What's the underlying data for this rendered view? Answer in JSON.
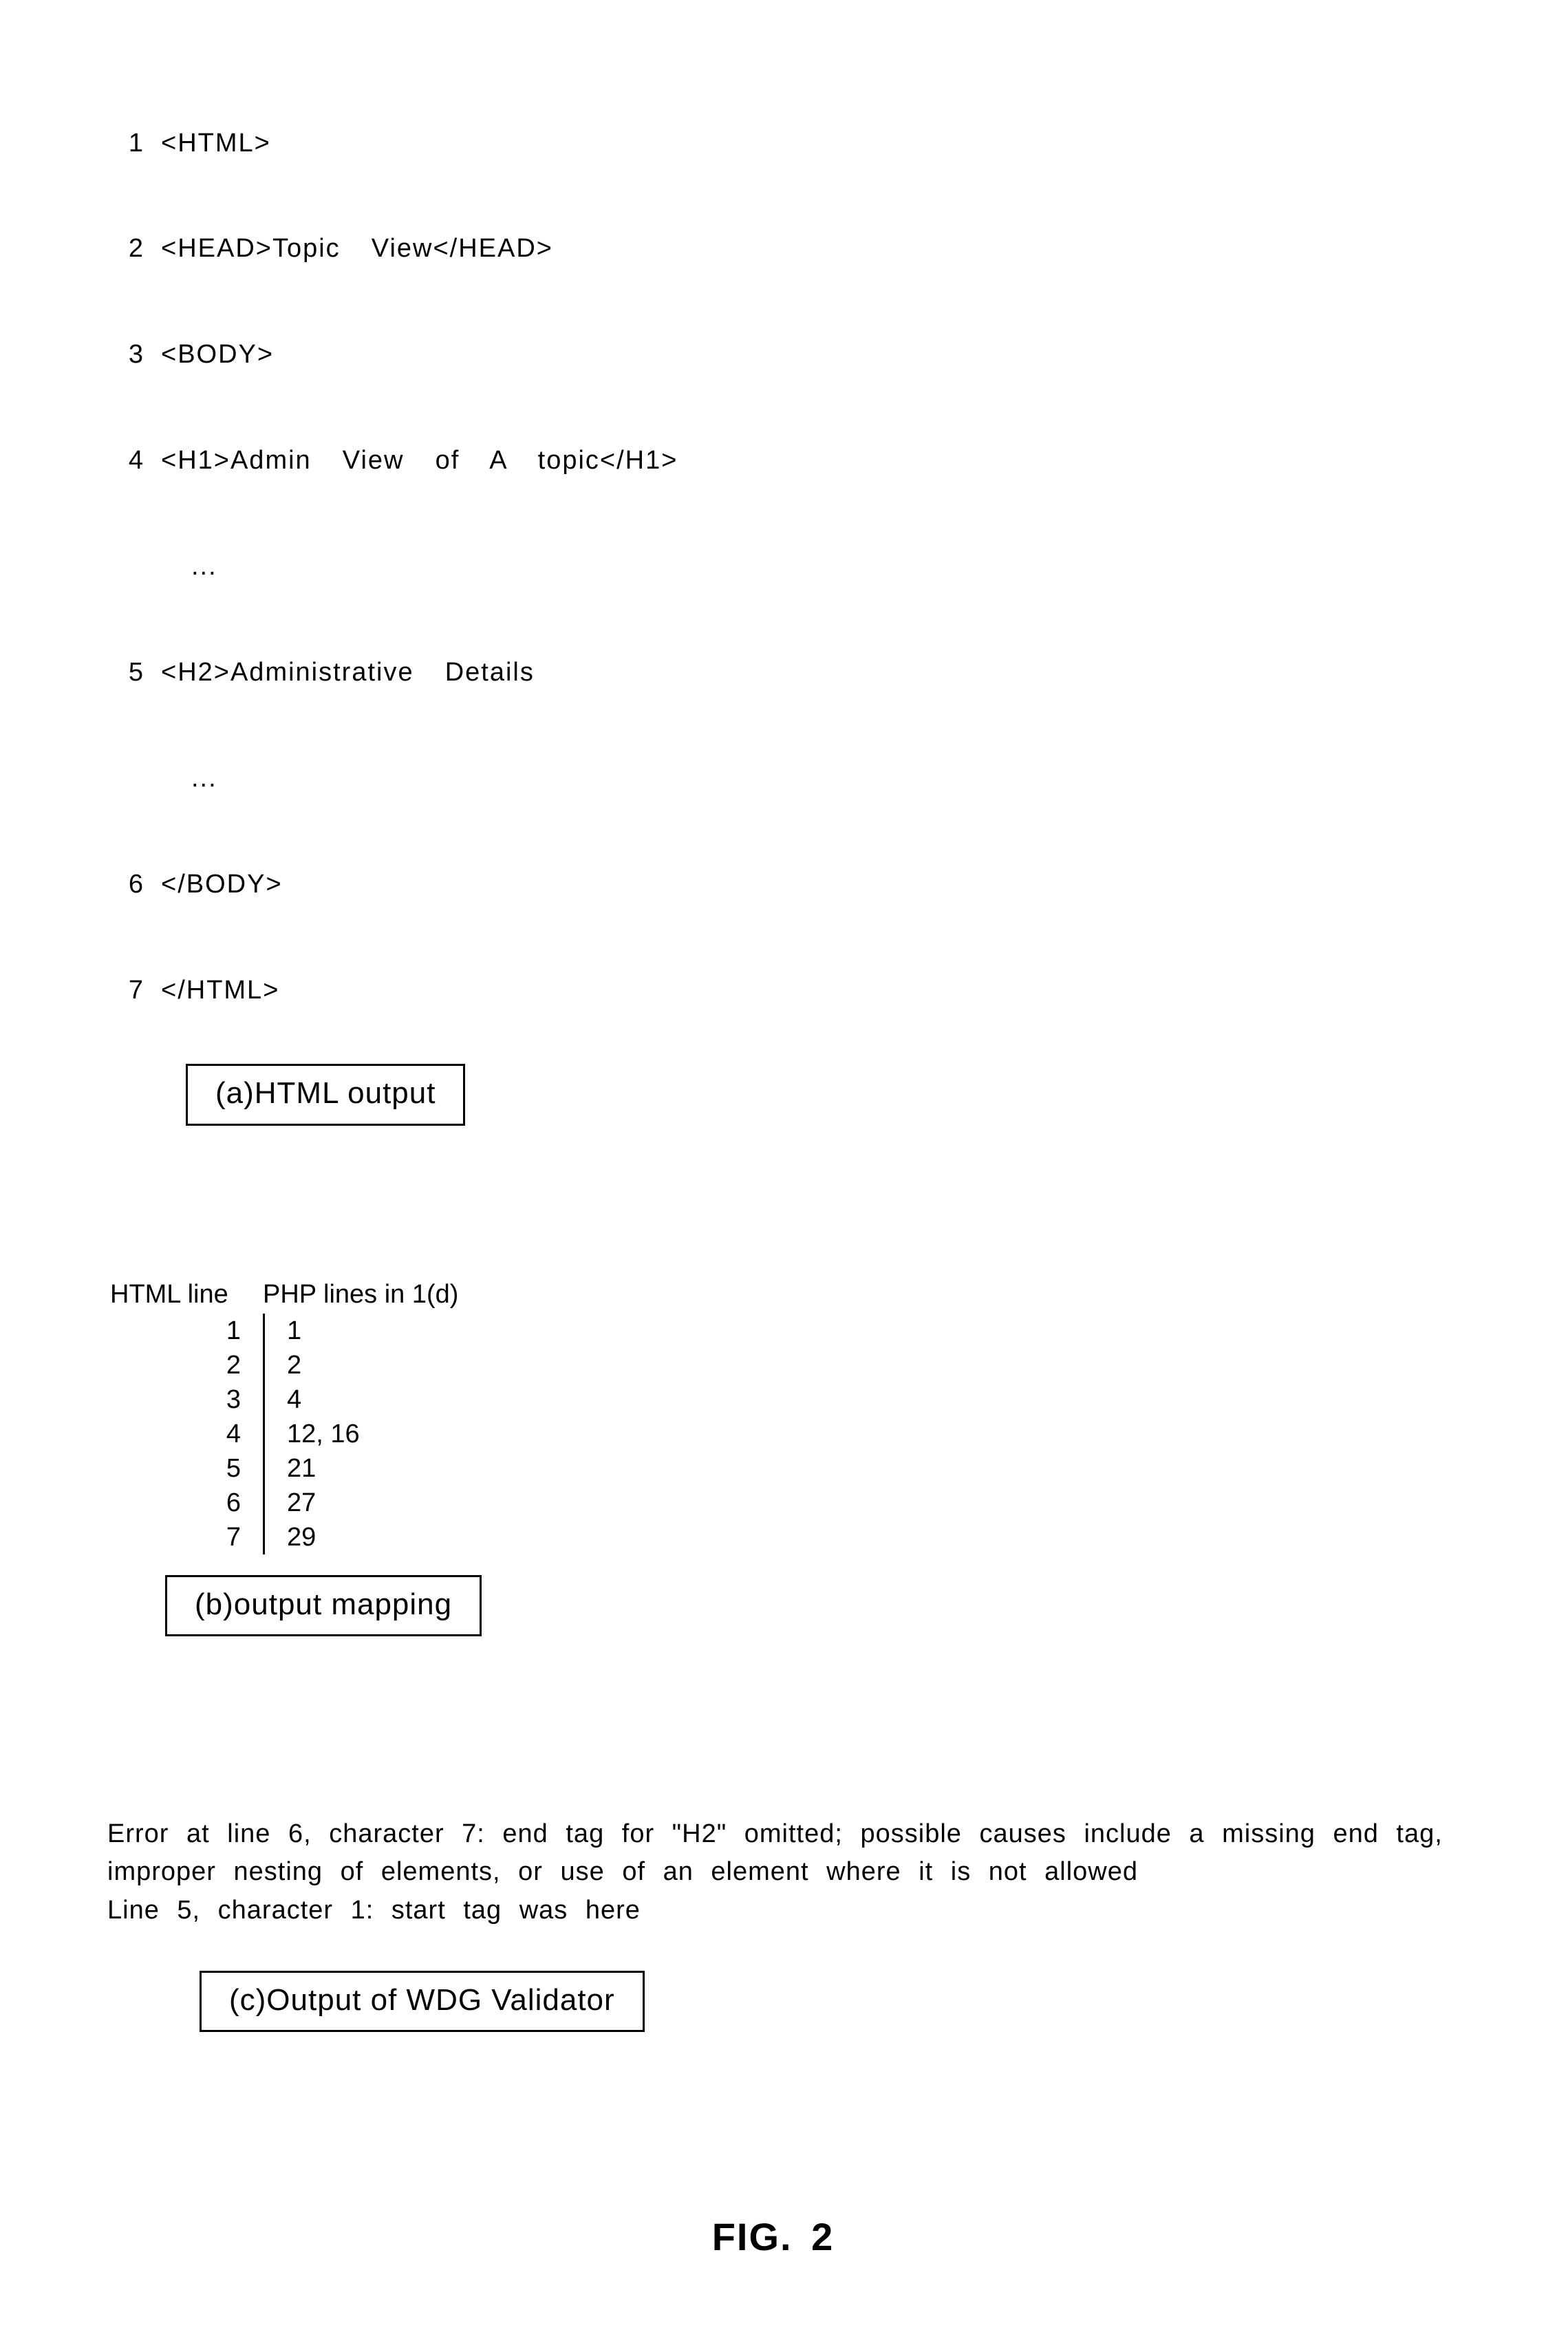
{
  "code": {
    "lines": [
      {
        "n": "1",
        "t": "<HTML>"
      },
      {
        "n": "2",
        "t": "<HEAD>Topic  View</HEAD>"
      },
      {
        "n": "3",
        "t": "<BODY>"
      },
      {
        "n": "4",
        "t": "<H1>Admin  View  of  A  topic</H1>"
      },
      {
        "n": "",
        "t": "..."
      },
      {
        "n": "5",
        "t": "<H2>Administrative  Details"
      },
      {
        "n": "",
        "t": "..."
      },
      {
        "n": "6",
        "t": "</BODY>"
      },
      {
        "n": "7",
        "t": "</HTML>"
      }
    ]
  },
  "captions": {
    "a": "(a)HTML output",
    "b": "(b)output mapping",
    "c": "(c)Output of WDG Validator"
  },
  "mapping": {
    "headers": {
      "left": "HTML line",
      "right": "PHP lines in 1(d)"
    },
    "rows": [
      {
        "html": "1",
        "php": "1"
      },
      {
        "html": "2",
        "php": "2"
      },
      {
        "html": "3",
        "php": "4"
      },
      {
        "html": "4",
        "php": "12, 16"
      },
      {
        "html": "5",
        "php": "21"
      },
      {
        "html": "6",
        "php": "27"
      },
      {
        "html": "7",
        "php": "29"
      }
    ]
  },
  "error": {
    "line1": "Error  at  line  6,  character  7:    end  tag  for  \"H2\"  omitted;  possible  causes  include  a  missing end  tag,  improper  nesting  of  elements,  or  use  of  an  element  where  it  is  not  allowed",
    "line2": "Line  5,  character  1:    start  tag  was  here"
  },
  "figure_label": "FIG.  2"
}
